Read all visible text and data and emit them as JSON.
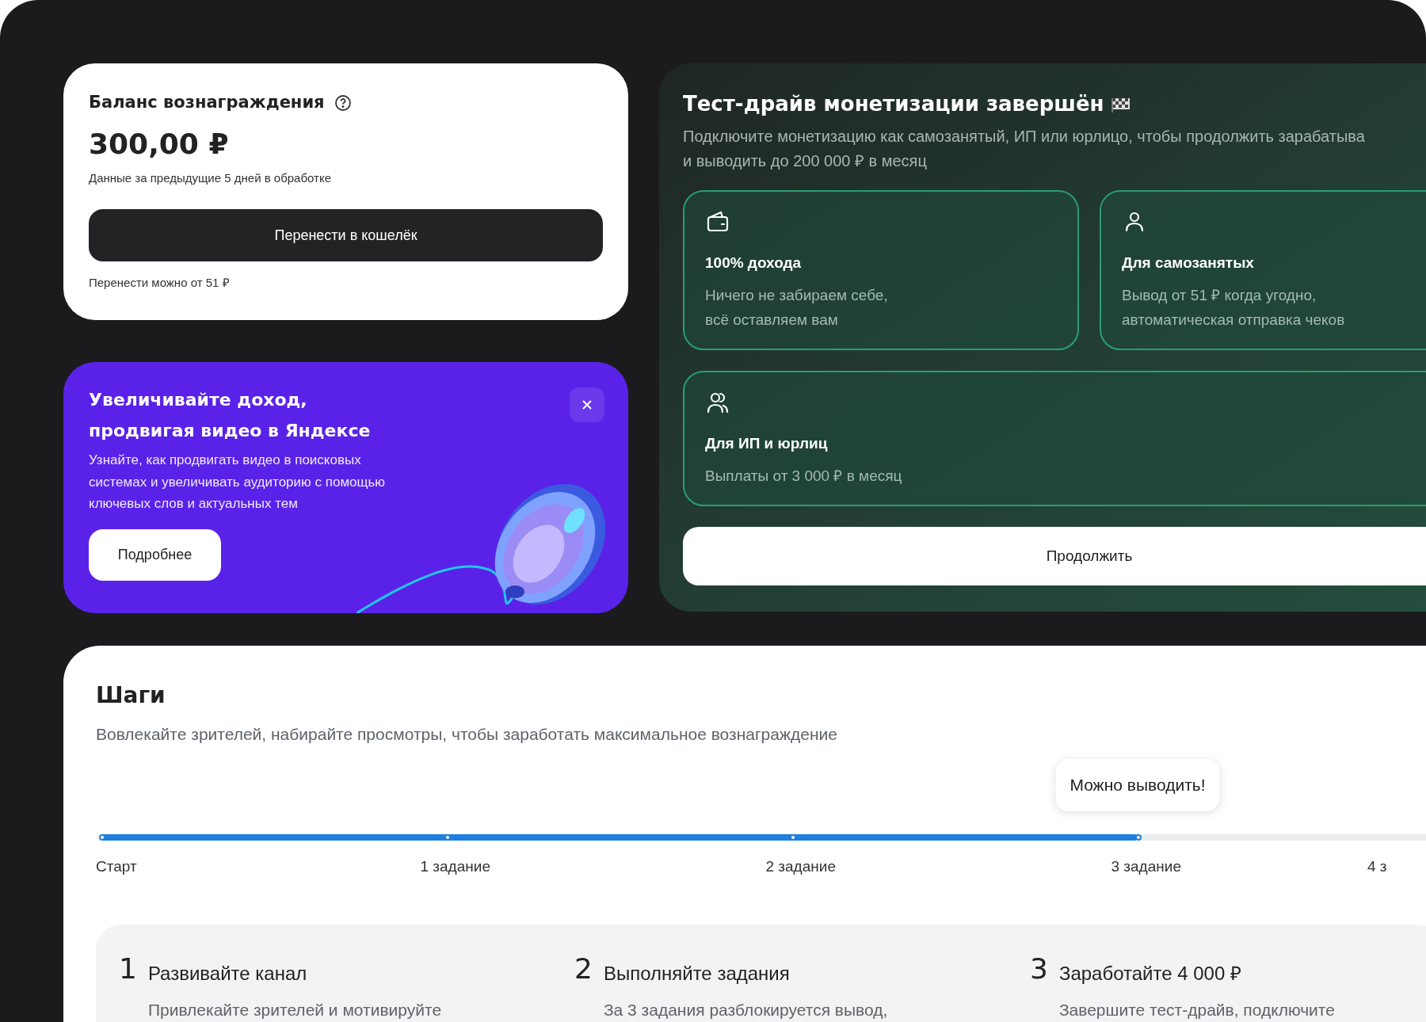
{
  "balance": {
    "title": "Баланс вознаграждения",
    "amount": "300,00 ₽",
    "note": "Данные за предыдущие 5 дней в обработке",
    "button": "Перенести в кошелёк",
    "footnote": "Перенести можно от 51 ₽"
  },
  "promo": {
    "title": "Увеличивайте доход,\nпродвигая видео в Яндексе",
    "text": "Узнайте, как продвигать видео в поисковых\nсистемах и увеличивать аудиторию с помощью\nключевых слов и актуальных тем",
    "button": "Подробнее"
  },
  "monetization": {
    "title": "Тест-драйв монетизации завершён",
    "description": "Подключите монетизацию как самозанятый, ИП или юрлицо, чтобы продолжить зарабатыва\nи выводить до 200 000 ₽ в месяц",
    "options": [
      {
        "kind": "wallet",
        "title": "100% дохода",
        "text": "Ничего не забираем себе,\nвсё оставляем вам"
      },
      {
        "kind": "person",
        "title": "Для самозанятых",
        "text": "Вывод от 51 ₽ когда угодно,\nавтоматическая отправка чеков"
      },
      {
        "kind": "people",
        "title": "Для ИП и юрлиц",
        "text": "Выплаты от 3 000 ₽ в месяц"
      }
    ],
    "button": "Продолжить"
  },
  "steps": {
    "title": "Шаги",
    "subtitle": "Вовлекайте зрителей, набирайте просмотры, чтобы заработать максимальное вознаграждение",
    "progress": {
      "level": 0.77,
      "tooltip": "Можно выводить!",
      "milestones": [
        {
          "label": "Старт"
        },
        {
          "label": "1 задание"
        },
        {
          "label": "2 задание"
        },
        {
          "label": "3 задание"
        },
        {
          "label": "4 з"
        }
      ]
    },
    "items": [
      {
        "number": "1",
        "title": "Развивайте канал",
        "text": "Привлекайте зрителей и мотивируйте"
      },
      {
        "number": "2",
        "title": "Выполняйте задания",
        "text": "За 3 задания разблокируется вывод,"
      },
      {
        "number": "3",
        "title": "Заработайте 4 000 ₽",
        "text": "Завершите тест-драйв, подключите"
      }
    ]
  }
}
